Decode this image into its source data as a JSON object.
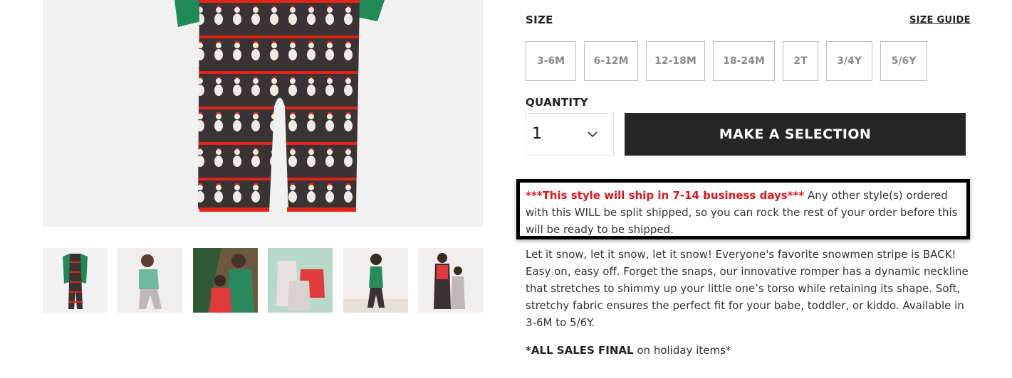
{
  "product": {
    "image_alt": "Snowmen stripe romper"
  },
  "thumbnails": [
    {
      "name": "romper-flat"
    },
    {
      "name": "child-jumping"
    },
    {
      "name": "mother-child-tree"
    },
    {
      "name": "matching-set"
    },
    {
      "name": "child-standing"
    },
    {
      "name": "siblings"
    }
  ],
  "size": {
    "label": "SIZE",
    "guide_label": "SIZE GUIDE",
    "options": [
      "3-6M",
      "6-12M",
      "12-18M",
      "18-24M",
      "2T",
      "3/4Y",
      "5/6Y"
    ]
  },
  "quantity": {
    "label": "QUANTITY",
    "value": "1"
  },
  "cta": {
    "label": "MAKE A SELECTION"
  },
  "notice": {
    "highlight": "***This style will ship in 7-14 business days***",
    "text": " Any other style(s) ordered with this WILL be split shipped, so you can rock the rest of your order before this will be ready to be shipped."
  },
  "description": "Let it snow, let it snow, let it snow! Everyone's favorite snowmen stripe is BACK! Easy on, easy off. Forget the snaps, our innovative romper has a dynamic neckline that stretches to shimmy up your little one’s torso while retaining its shape. Soft, stretchy fabric ensures the perfect fit for your babe, toddler, or kiddo. Available in 3-6M to 5/6Y.",
  "sales_final": {
    "bold": "*ALL SALES FINAL",
    "text": " on holiday items*"
  },
  "colors": {
    "notice_red": "#e0141e",
    "cta_bg": "#262626",
    "romper_dark": "#3a3334",
    "stripe_red": "#e2231a",
    "sleeve_green": "#1f8a55"
  }
}
